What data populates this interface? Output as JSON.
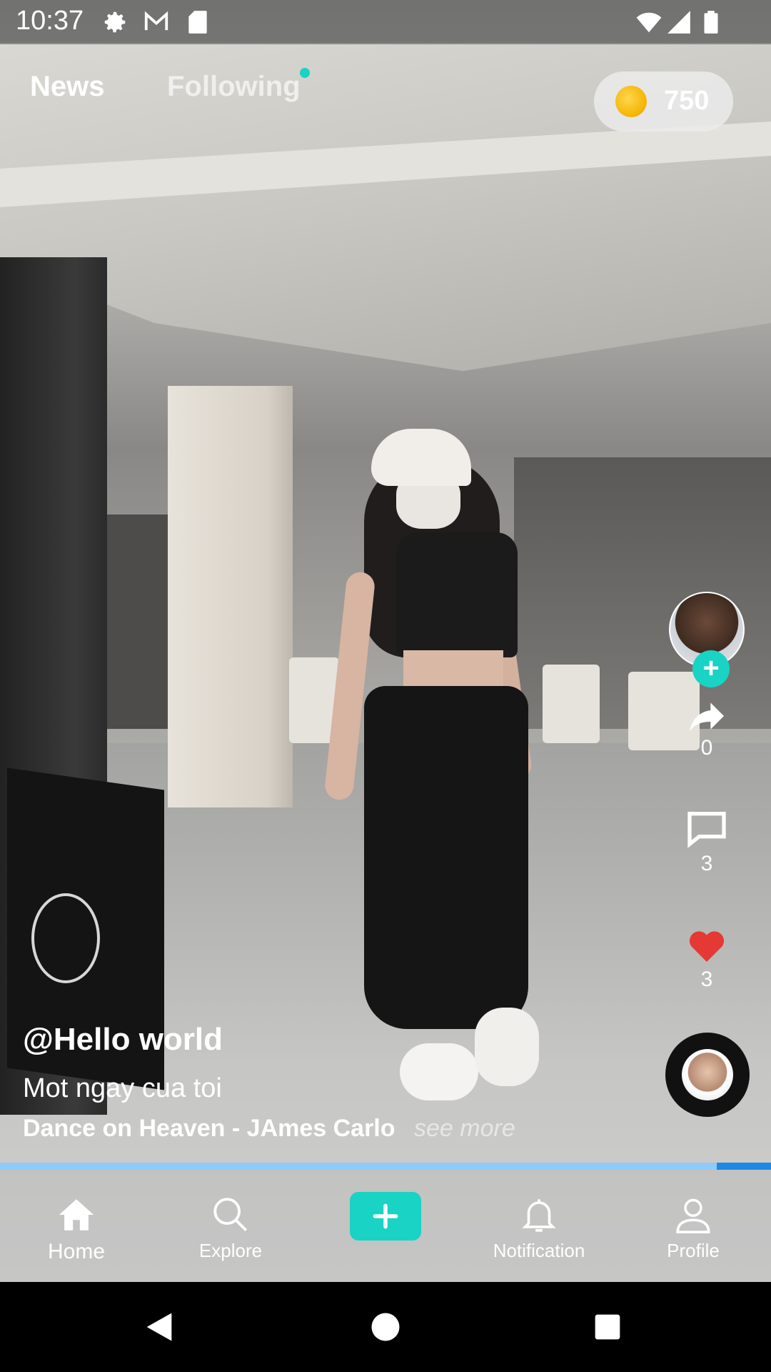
{
  "status_bar": {
    "time": "10:37",
    "icons": [
      "settings-icon",
      "gmail-icon",
      "sd-card-icon",
      "wifi-icon",
      "signal-icon",
      "battery-icon"
    ]
  },
  "top_tabs": {
    "items": [
      {
        "label": "News",
        "active": true
      },
      {
        "label": "Following",
        "active": false
      }
    ]
  },
  "coins": {
    "icon": "coin-icon",
    "value": "750"
  },
  "right_rail": {
    "share_count": "0",
    "comment_count": "3",
    "like_count": "3",
    "like_color": "#e53935"
  },
  "caption": {
    "username": "@Hello world",
    "description": "Mot ngay cua toi",
    "music": "Dance on Heaven - JAmes Carlo",
    "see_more": "see more"
  },
  "progress": {
    "fraction": 0.93,
    "track_color": "#1e88e5",
    "fill_color": "#90caf9"
  },
  "bottom_nav": {
    "items": [
      {
        "label": "Home",
        "icon": "home-icon"
      },
      {
        "label": "Explore",
        "icon": "search-icon"
      },
      {
        "label": "",
        "icon": "plus-icon"
      },
      {
        "label": "Notification",
        "icon": "bell-icon"
      },
      {
        "label": "Profile",
        "icon": "user-icon"
      }
    ],
    "accent": "#19d3c5"
  },
  "system_nav": {
    "icons": [
      "back-icon",
      "home-circle-icon",
      "recents-icon"
    ]
  }
}
